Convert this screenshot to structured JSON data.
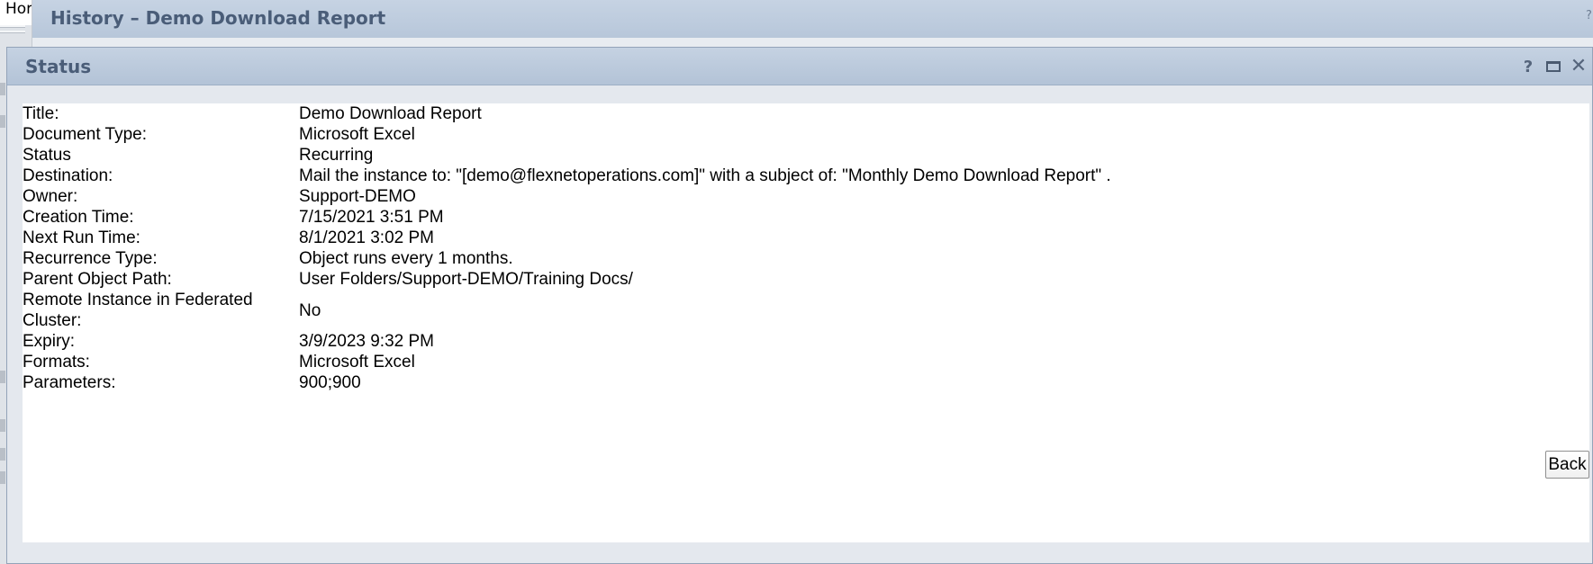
{
  "background": {
    "home_tab": "Hor",
    "history_window_title": "History – Demo Download Report"
  },
  "dialog": {
    "title": "Status",
    "controls": {
      "help_icon": "?",
      "maximize_icon": "maximize-icon",
      "close_icon": "✕"
    }
  },
  "properties": [
    {
      "label": "Title:",
      "value": "Demo Download Report"
    },
    {
      "label": "Document Type:",
      "value": "Microsoft Excel"
    },
    {
      "label": "Status",
      "value": "Recurring"
    },
    {
      "label": "Destination:",
      "value": "Mail the instance to: \"[demo@flexnetoperations.com]\" with a subject of: \"Monthly Demo Download Report\" ."
    },
    {
      "label": "Owner:",
      "value": "Support-DEMO"
    },
    {
      "label": "Creation Time:",
      "value": "7/15/2021 3:51 PM"
    },
    {
      "label": "Next Run Time:",
      "value": "8/1/2021 3:02 PM"
    },
    {
      "label": "Recurrence Type:",
      "value": "Object runs every 1 months."
    },
    {
      "label": "Parent Object Path:",
      "value": "User Folders/Support-DEMO/Training Docs/"
    },
    {
      "label": "Remote Instance in Federated Cluster:",
      "value": "No"
    },
    {
      "label": "Expiry:",
      "value": "3/9/2023 9:32 PM"
    },
    {
      "label": "Formats:",
      "value": "Microsoft Excel"
    },
    {
      "label": "Parameters:",
      "value": "900;900"
    }
  ],
  "buttons": {
    "back_label": "Back"
  },
  "colors": {
    "titlebar": "#b9c8db",
    "title_text": "#4a5d78",
    "dialog_bg": "#e4e8ee"
  }
}
